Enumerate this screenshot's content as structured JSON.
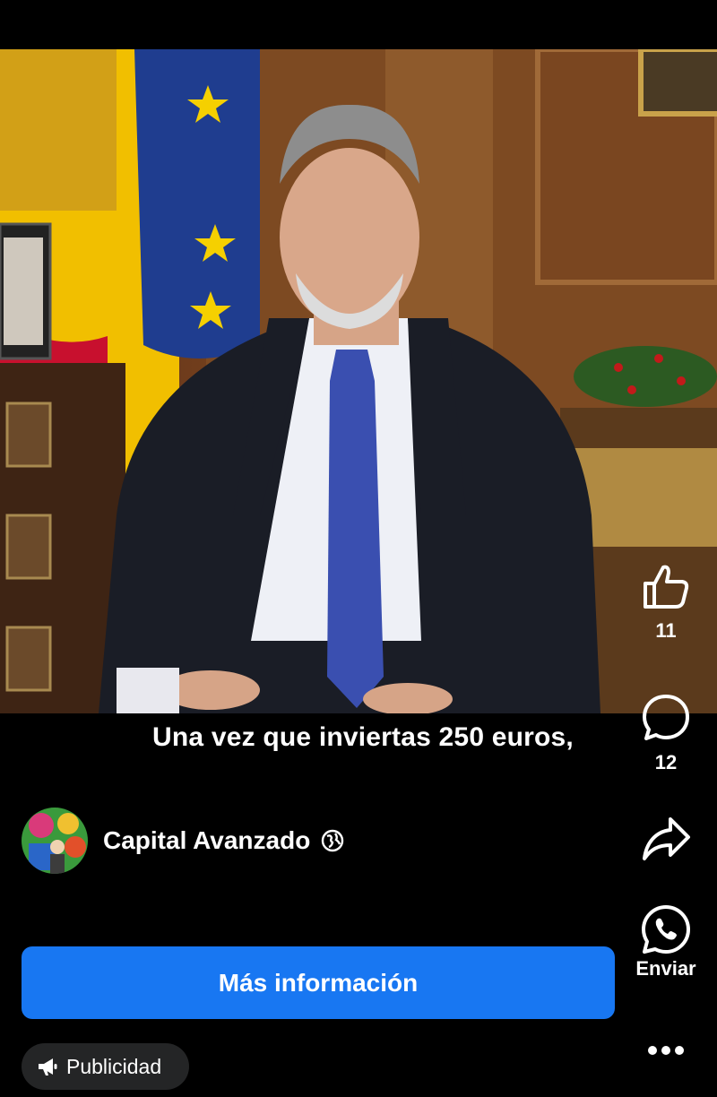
{
  "video": {
    "subtitle": "Una vez que inviertas 250 euros,"
  },
  "page": {
    "name": "Capital Avanzado"
  },
  "cta": {
    "label": "Más información"
  },
  "ad_badge": {
    "label": "Publicidad"
  },
  "actions": {
    "like_count": "11",
    "comment_count": "12",
    "whatsapp_label": "Enviar"
  },
  "icons": [
    "thumbs-up-icon",
    "comment-icon",
    "share-icon",
    "whatsapp-icon",
    "more-icon",
    "globe-icon",
    "megaphone-icon"
  ],
  "colors": {
    "cta": "#1877f2",
    "badge_bg": "#242526",
    "background": "#000000"
  }
}
